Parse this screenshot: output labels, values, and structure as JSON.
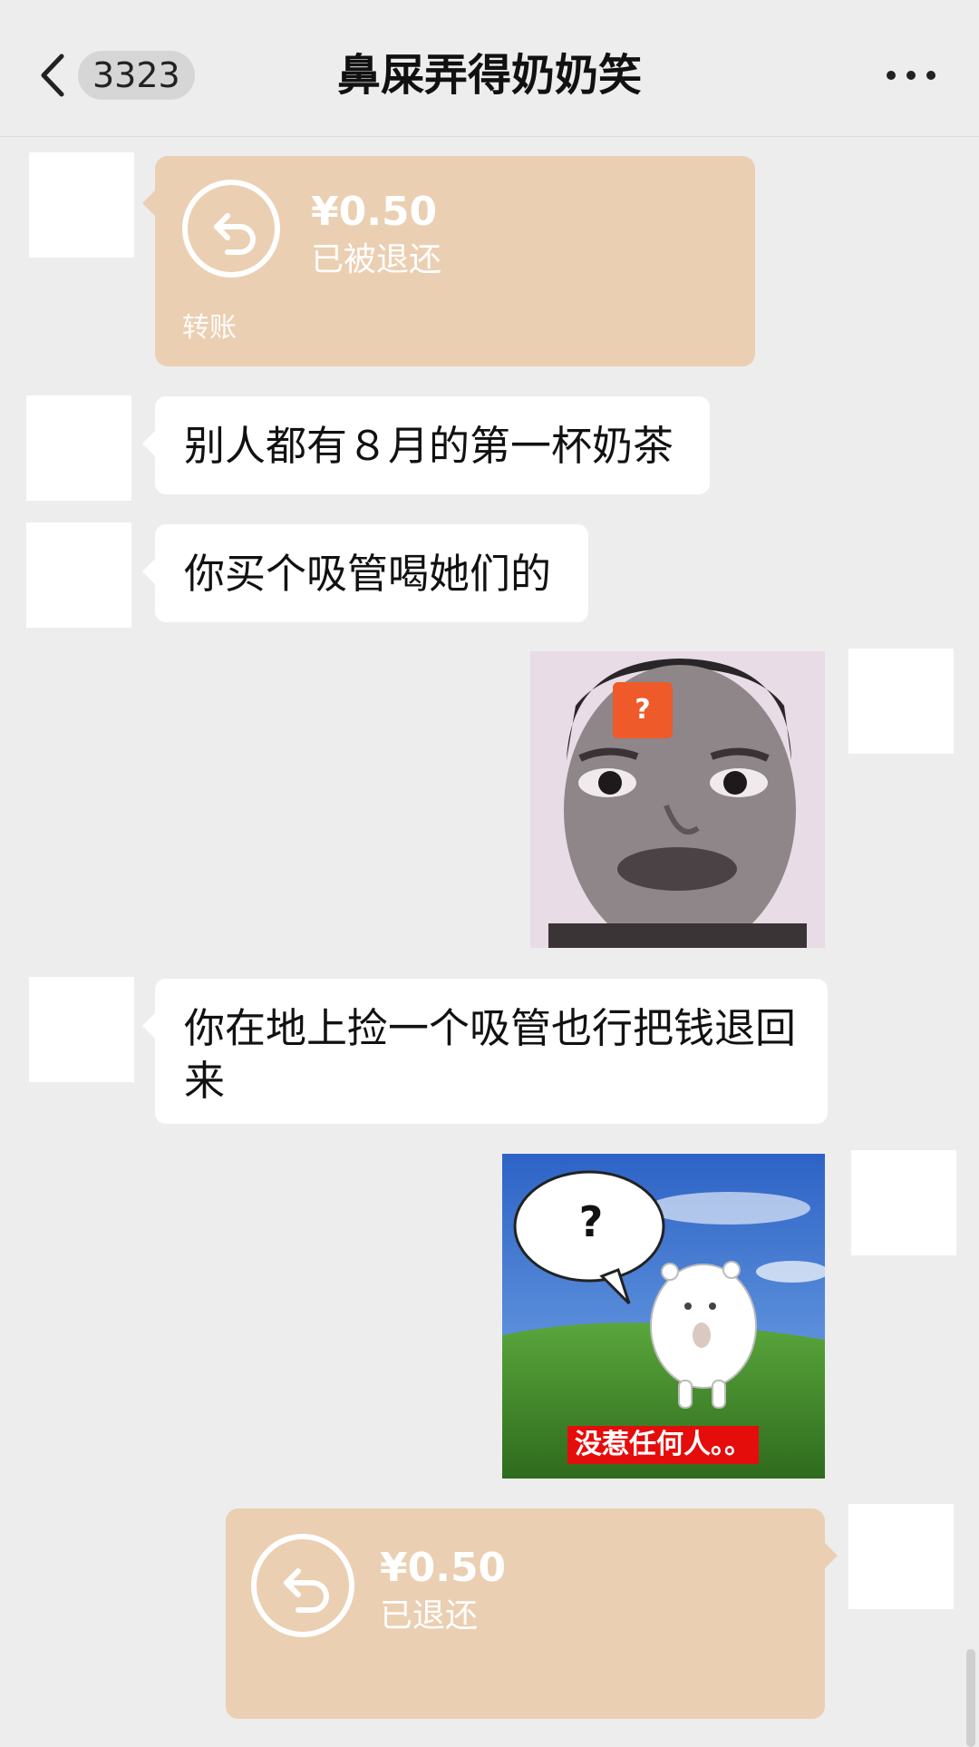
{
  "header": {
    "back_label": "back",
    "unread_count": "3323",
    "title": "鼻屎弄得奶奶笑",
    "more_label": "more"
  },
  "messages": {
    "m1": {
      "amount": "¥0.50",
      "status": "已被退还",
      "footer": "转账"
    },
    "m2": {
      "text": "别人都有８月的第一杯奶茶"
    },
    "m3": {
      "text": "你买个吸管喝她们的"
    },
    "m4": {
      "badge": "?"
    },
    "m5": {
      "text": "你在地上捡一个吸管也行把钱退回来"
    },
    "m6": {
      "bubble_text": "?",
      "caption": "没惹任何人。。"
    },
    "m7": {
      "amount": "¥0.50",
      "status": "已退还"
    }
  },
  "colors": {
    "background": "#ededed",
    "bubble": "#ffffff",
    "transfer": "#ebcfb2"
  }
}
